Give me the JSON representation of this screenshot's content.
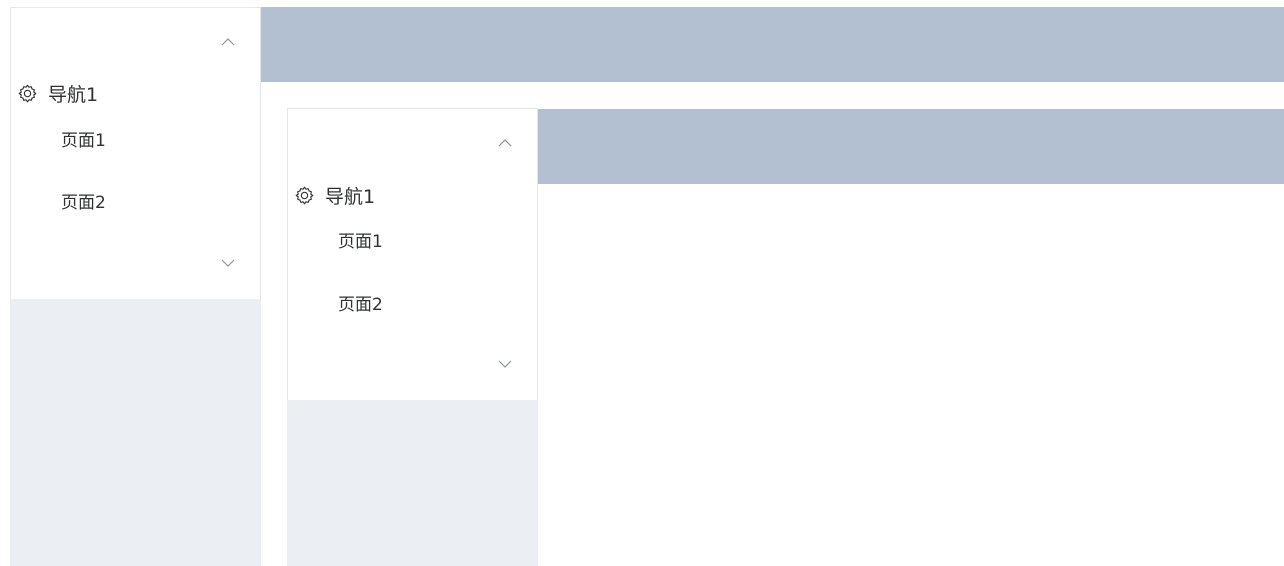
{
  "outer": {
    "sidebar": {
      "group_label": "导航1",
      "group_icon": "gear-icon",
      "items": [
        {
          "label": "页面1"
        },
        {
          "label": "页面2"
        }
      ],
      "scroll_up_icon": "chevron-up-icon",
      "scroll_down_icon": "chevron-down-icon"
    }
  },
  "inner": {
    "sidebar": {
      "group_label": "导航1",
      "group_icon": "gear-icon",
      "items": [
        {
          "label": "页面1"
        },
        {
          "label": "页面2"
        }
      ],
      "scroll_up_icon": "chevron-up-icon",
      "scroll_down_icon": "chevron-down-icon"
    }
  },
  "colors": {
    "header": "#b3c0d1",
    "aside_bg": "#ebeef3",
    "menu_bg": "#ffffff",
    "text": "#303133"
  }
}
